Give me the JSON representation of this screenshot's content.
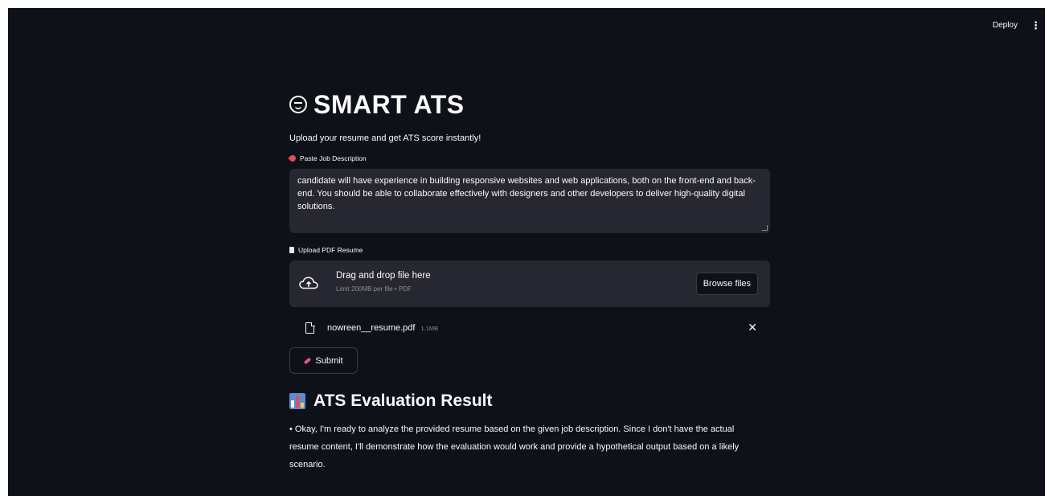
{
  "topbar": {
    "deploy_label": "Deploy",
    "menu_glyph": "⋮"
  },
  "header": {
    "title": "SMART ATS",
    "title_icon": "smiley-face-icon",
    "subtitle": "Upload your resume and get ATS score instantly!"
  },
  "job_description": {
    "label": "Paste Job Description",
    "label_icon": "pushpin-icon",
    "value": "candidate will have experience in building responsive websites and web applications, both on the front-end and back-end. You should be able to collaborate effectively with designers and other developers to deliver high-quality digital solutions."
  },
  "upload": {
    "label": "Upload PDF Resume",
    "label_icon": "page-icon",
    "dropzone_text": "Drag and drop file here",
    "limit_text": "Limit 200MB per file • PDF",
    "browse_label": "Browse files",
    "cloud_icon": "cloud-upload-icon"
  },
  "uploaded_file": {
    "name": "nowreen__resume.pdf",
    "size": "1.1MB",
    "remove_glyph": "✕"
  },
  "submit": {
    "label": "Submit",
    "icon": "rocket-icon"
  },
  "result": {
    "title": "ATS Evaluation Result",
    "icon": "bar-chart-icon",
    "body": "• Okay, I'm ready to analyze the provided resume based on the given job description. Since I don't have the actual resume content, I'll demonstrate how the evaluation would work and provide a hypothetical output based on a likely scenario."
  },
  "colors": {
    "background": "#0e1117",
    "surface": "#262730",
    "text": "#fafafa",
    "muted": "#8b8d95",
    "accent_red": "#e24e5c",
    "accent_pink": "#e0597d",
    "chart_blue": "#5a8ccf"
  }
}
